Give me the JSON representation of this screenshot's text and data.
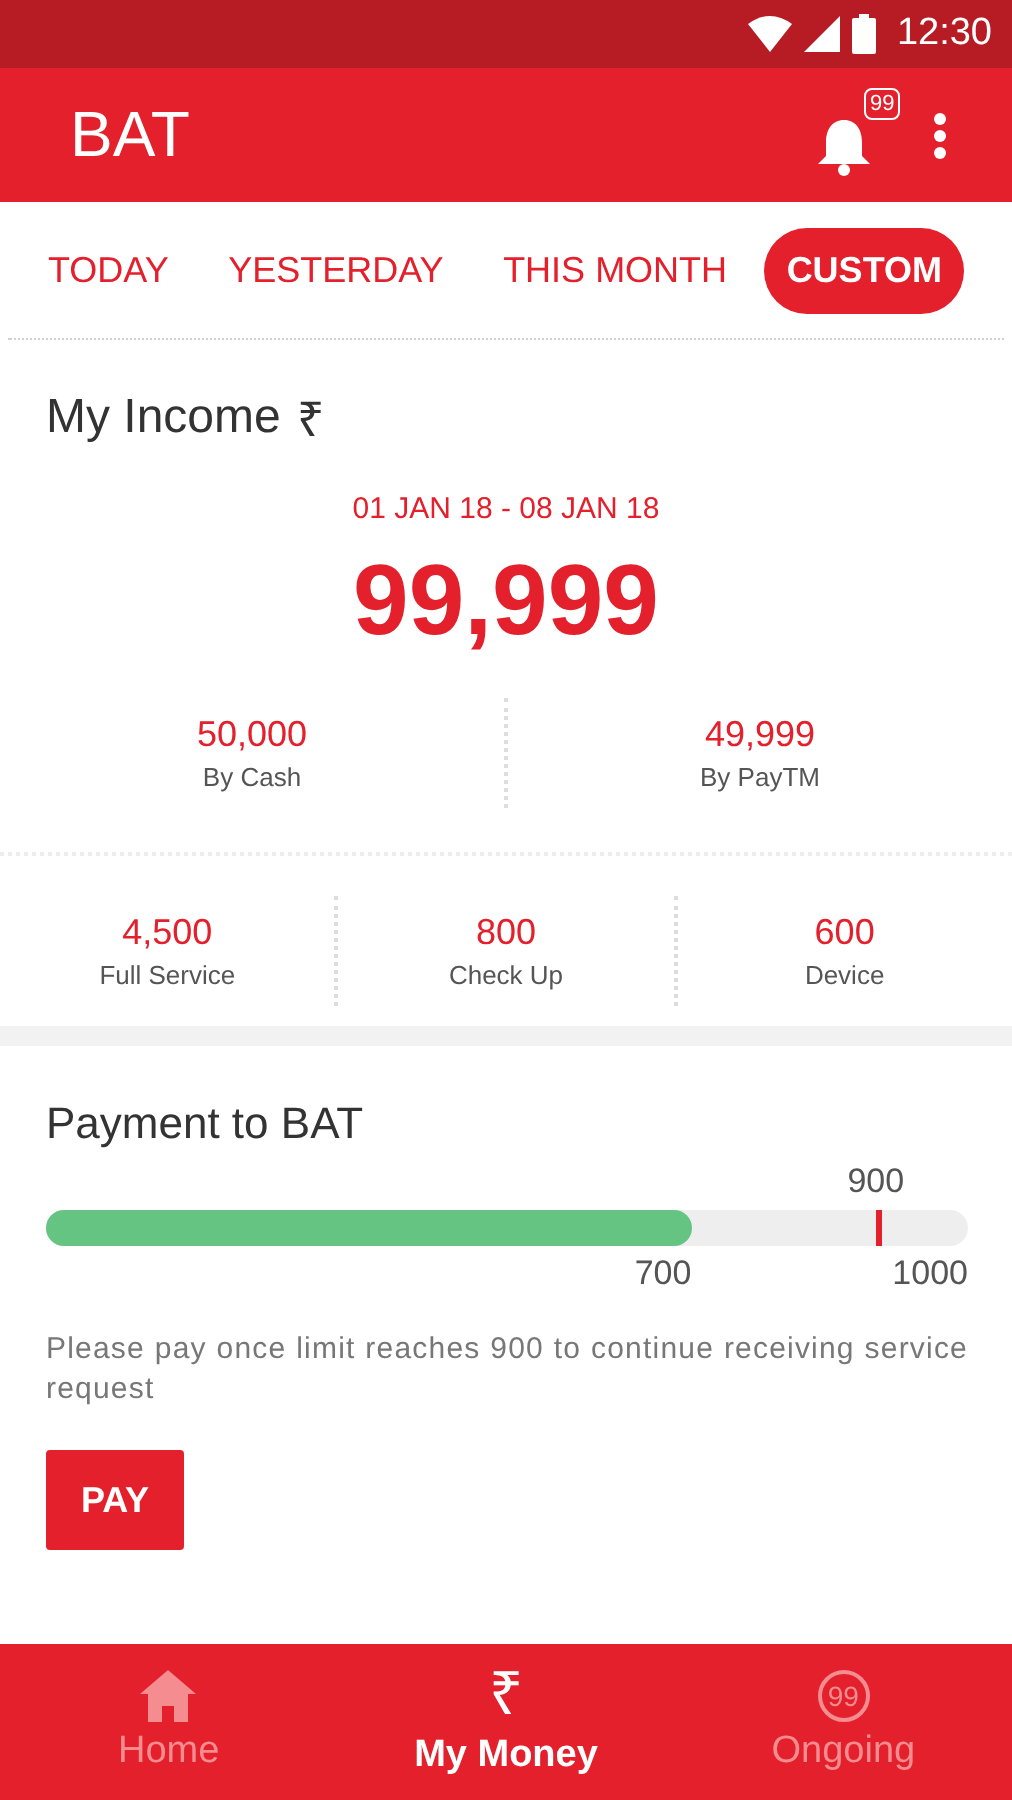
{
  "status_bar": {
    "time": "12:30"
  },
  "app_bar": {
    "title": "BAT",
    "notification_count": "99"
  },
  "tabs": [
    {
      "label": "TODAY",
      "selected": false
    },
    {
      "label": "YESTERDAY",
      "selected": false
    },
    {
      "label": "THIS MONTH",
      "selected": false
    },
    {
      "label": "CUSTOM",
      "selected": true
    }
  ],
  "income": {
    "title": "My Income",
    "currency_symbol": "₹",
    "date_range": "01 JAN 18 - 08 JAN 18",
    "total": "99,999",
    "by_method": [
      {
        "value": "50,000",
        "label": "By Cash"
      },
      {
        "value": "49,999",
        "label": "By PayTM"
      }
    ],
    "by_service": [
      {
        "value": "4,500",
        "label": "Full Service"
      },
      {
        "value": "800",
        "label": "Check Up"
      },
      {
        "value": "600",
        "label": "Device"
      }
    ]
  },
  "payment": {
    "title": "Payment to BAT",
    "level": 0.7,
    "current_label": "700",
    "max_label": "1000",
    "limit": {
      "level": 0.9,
      "label": "900"
    },
    "note": "Please pay once limit reaches 900 to continue receiving service request",
    "button": "PAY"
  },
  "bottom_nav": [
    {
      "kind": "home",
      "label": "Home",
      "selected": false
    },
    {
      "kind": "rupee",
      "icon_text": "₹",
      "label": "My Money",
      "selected": true
    },
    {
      "kind": "count",
      "icon_text": "99",
      "label": "Ongoing",
      "selected": false
    }
  ]
}
